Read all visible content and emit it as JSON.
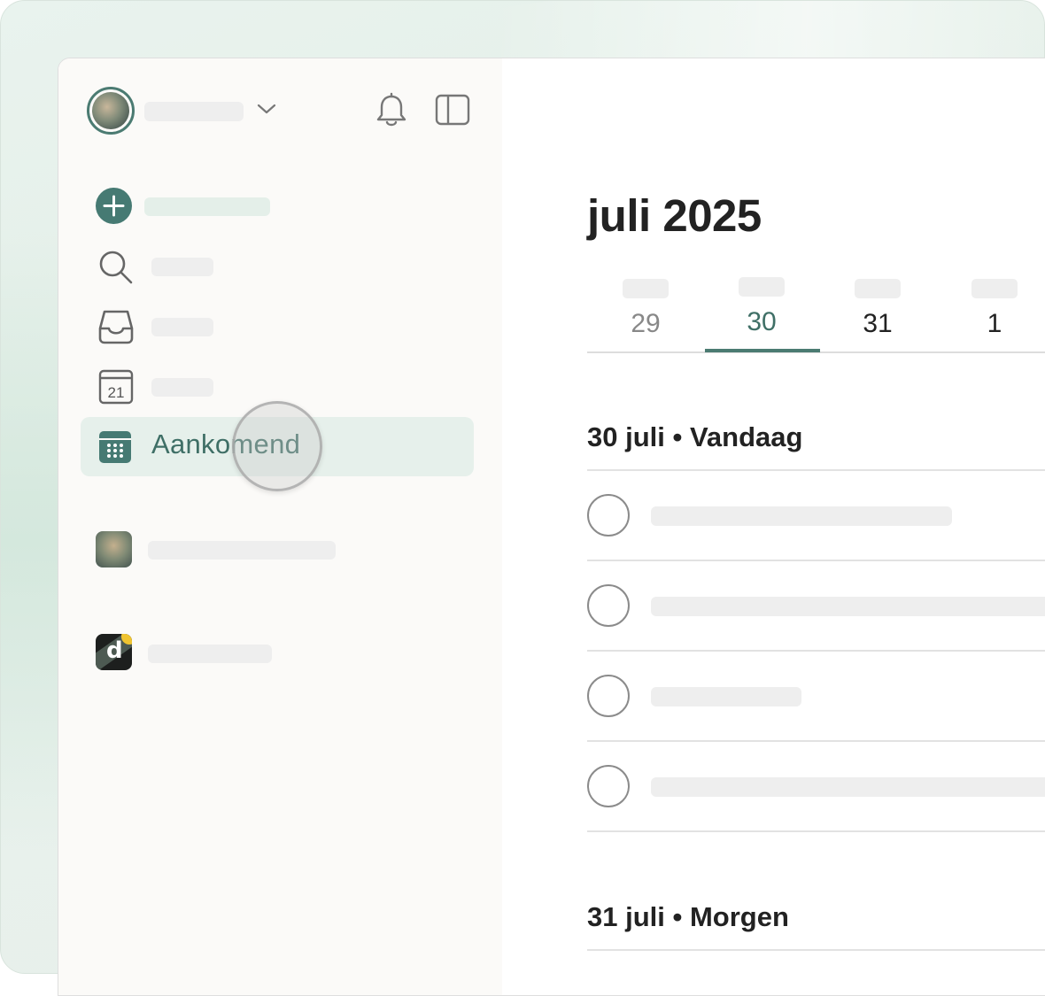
{
  "sidebar": {
    "active_item": {
      "label": "Aankomend",
      "icon": "upcoming-calendar-icon"
    },
    "icons": {
      "add": "plus-icon",
      "search": "search-icon",
      "inbox": "inbox-icon",
      "today": "calendar-today-icon",
      "today_number": "21",
      "notifications": "bell-icon",
      "toggle_sidebar": "sidebar-panel-icon",
      "account_menu": "chevron-down-icon",
      "team_letter": "d"
    }
  },
  "main": {
    "month_title": "juli 2025",
    "week_days": [
      {
        "num": "29",
        "state": "past"
      },
      {
        "num": "30",
        "state": "active"
      },
      {
        "num": "31",
        "state": "future"
      },
      {
        "num": "1",
        "state": "future"
      }
    ],
    "sections": [
      {
        "title": "30 juli • Vandaag"
      },
      {
        "title": "31 juli • Morgen"
      }
    ]
  },
  "colors": {
    "accent": "#4b7b72",
    "active_bg": "#e6f0eb",
    "sidebar_bg": "#fbfaf8",
    "placeholder": "#eeeeee"
  }
}
